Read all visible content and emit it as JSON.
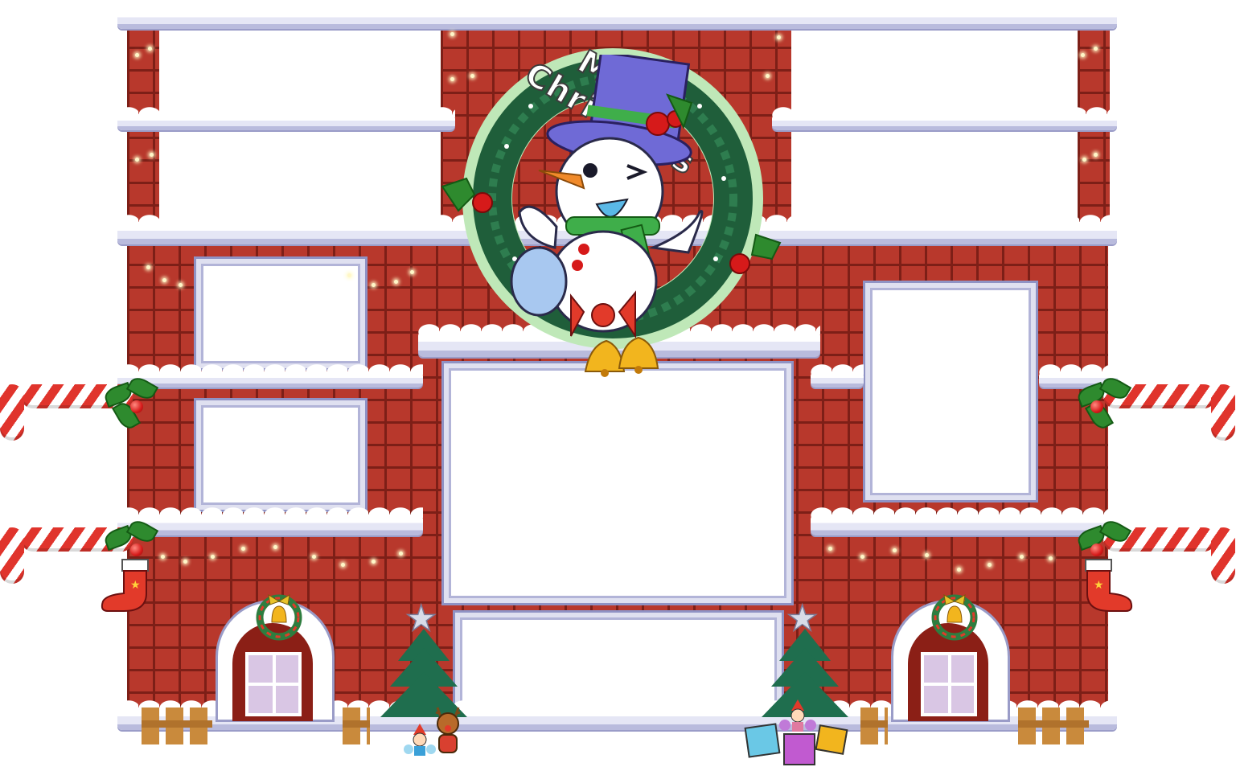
{
  "scene": {
    "name": "christmas-house-frame",
    "colors": {
      "brick": "#b8382c",
      "mortar": "#7d1f17",
      "snow": "#ffffff",
      "ledge_shadow": "#b9bbdd",
      "wreath": "#1f5e3a",
      "hat": "#6f6ad6"
    }
  },
  "wreath_banner": {
    "text": "Merry Christmas"
  },
  "icons": {
    "snowman": "snowman-icon",
    "bell": "bell-icon",
    "holly": "holly-icon",
    "candy_cane": "candy-cane-icon",
    "stocking": "stocking-icon",
    "tree": "christmas-tree-icon",
    "reindeer": "reindeer-icon",
    "gift": "gift-icon",
    "star": "star-icon"
  },
  "glyphs": {
    "star": "★"
  }
}
